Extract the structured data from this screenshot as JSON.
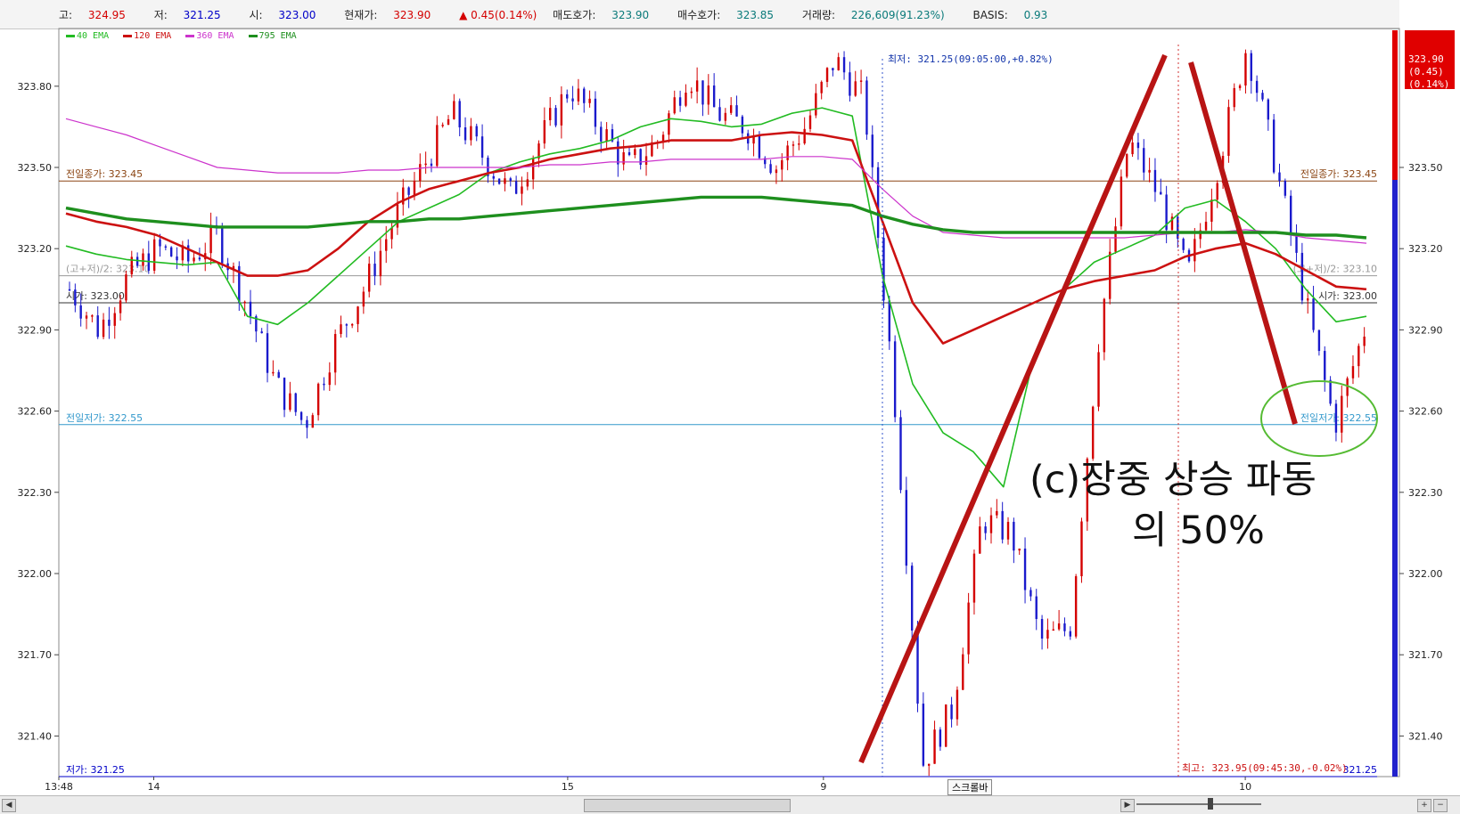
{
  "header": {
    "high_label": "고:",
    "high": "324.95",
    "low_label": "저:",
    "low": "321.25",
    "open_label": "시:",
    "open": "323.00",
    "price_label": "현재가:",
    "price": "323.90",
    "change": "▲ 0.45(0.14%)",
    "ask_label": "매도호가:",
    "ask": "323.90",
    "bid_label": "매수호가:",
    "bid": "323.85",
    "volume_label": "거래량:",
    "volume": "226,609(91.23%)",
    "basis_label": "BASIS:",
    "basis": "0.93"
  },
  "legend": [
    {
      "label": "40 EMA",
      "color": "#22bb22"
    },
    {
      "label": "120 EMA",
      "color": "#cc1111"
    },
    {
      "label": "360 EMA",
      "color": "#cc33cc"
    },
    {
      "label": "795 EMA",
      "color": "#1e8f1e"
    }
  ],
  "chart_data": {
    "type": "line",
    "ylim": [
      321.25,
      324.0
    ],
    "y_ticks": [
      "321.40",
      "321.70",
      "322.00",
      "322.30",
      "322.60",
      "322.90",
      "323.20",
      "323.50",
      "323.80"
    ],
    "x_ticks": [
      "13:48",
      "14",
      "15",
      "9",
      "10"
    ],
    "reference_lines": [
      {
        "label": "전일종가: 323.45",
        "right_label": "전일종가: 323.45",
        "value": 323.45,
        "color": "#8b4513"
      },
      {
        "label": "(고+저)/2: 323.10",
        "right_label": "(고+저)/2: 323.10",
        "value": 323.1,
        "color": "#999999"
      },
      {
        "label": "시가: 323.00",
        "right_label": "시가: 323.00",
        "value": 323.0,
        "color": "#333333"
      },
      {
        "label": "전일저가: 322.55",
        "right_label": "전일저가: 322.55",
        "value": 322.55,
        "color": "#3399cc"
      },
      {
        "label": "저가: 321.25",
        "right_label": "321.25",
        "value": 321.25,
        "color": "#0000c8"
      }
    ],
    "annotations": {
      "low_point": "최저: 321.25(09:05:00,+0.82%)",
      "high_point": "최고: 323.95(09:45:30,-0.02%)",
      "text_line1": "(c)장중 상승 파동",
      "text_line2": "의 50%"
    },
    "current_price_box": [
      "323.90",
      "(0.45)",
      "(0.14%)"
    ],
    "right_axis_ticks": [
      "323.50",
      "323.20",
      "322.90",
      "322.60",
      "322.30",
      "322.00",
      "321.70",
      "321.40"
    ],
    "series": [
      {
        "name": "40 EMA",
        "color": "#22bb22",
        "values": [
          323.21,
          323.18,
          323.16,
          323.15,
          323.14,
          323.15,
          322.95,
          322.92,
          323.0,
          323.1,
          323.2,
          323.3,
          323.35,
          323.4,
          323.48,
          323.52,
          323.55,
          323.57,
          323.6,
          323.65,
          323.68,
          323.67,
          323.65,
          323.66,
          323.7,
          323.72,
          323.69,
          323.1,
          322.7,
          322.52,
          322.45,
          322.32,
          322.8,
          323.05,
          323.15,
          323.2,
          323.25,
          323.35,
          323.38,
          323.3,
          323.2,
          323.05,
          322.93,
          322.95
        ]
      },
      {
        "name": "120 EMA",
        "color": "#cc1111",
        "values": [
          323.33,
          323.3,
          323.28,
          323.25,
          323.2,
          323.15,
          323.1,
          323.1,
          323.12,
          323.2,
          323.3,
          323.37,
          323.42,
          323.45,
          323.48,
          323.5,
          323.53,
          323.55,
          323.57,
          323.58,
          323.6,
          323.6,
          323.6,
          323.62,
          323.63,
          323.62,
          323.6,
          323.3,
          323.0,
          322.85,
          322.9,
          322.95,
          323.0,
          323.05,
          323.08,
          323.1,
          323.12,
          323.17,
          323.2,
          323.22,
          323.18,
          323.12,
          323.06,
          323.05
        ]
      },
      {
        "name": "360 EMA",
        "color": "#cc33cc",
        "values": [
          323.68,
          323.65,
          323.62,
          323.58,
          323.54,
          323.5,
          323.49,
          323.48,
          323.48,
          323.48,
          323.49,
          323.49,
          323.5,
          323.5,
          323.5,
          323.5,
          323.51,
          323.51,
          323.52,
          323.52,
          323.53,
          323.53,
          323.53,
          323.53,
          323.54,
          323.54,
          323.53,
          323.42,
          323.32,
          323.26,
          323.25,
          323.24,
          323.24,
          323.24,
          323.24,
          323.24,
          323.25,
          323.26,
          323.26,
          323.27,
          323.26,
          323.24,
          323.23,
          323.22
        ]
      },
      {
        "name": "795 EMA",
        "color": "#1e8f1e",
        "values": [
          323.35,
          323.33,
          323.31,
          323.3,
          323.29,
          323.28,
          323.28,
          323.28,
          323.28,
          323.29,
          323.3,
          323.3,
          323.31,
          323.31,
          323.32,
          323.33,
          323.34,
          323.35,
          323.36,
          323.37,
          323.38,
          323.39,
          323.39,
          323.39,
          323.38,
          323.37,
          323.36,
          323.32,
          323.29,
          323.27,
          323.26,
          323.26,
          323.26,
          323.26,
          323.26,
          323.26,
          323.26,
          323.26,
          323.26,
          323.26,
          323.26,
          323.25,
          323.25,
          323.24
        ]
      }
    ],
    "price_path": [
      323.05,
      322.9,
      323.1,
      323.2,
      323.15,
      323.25,
      323.0,
      322.7,
      322.55,
      322.85,
      323.05,
      323.3,
      323.5,
      323.7,
      323.55,
      323.4,
      323.6,
      323.8,
      323.65,
      323.5,
      323.6,
      323.85,
      323.7,
      323.65,
      323.5,
      323.65,
      323.9,
      323.75,
      322.7,
      321.3,
      321.5,
      322.2,
      322.15,
      321.75,
      321.8,
      322.9,
      323.6,
      323.4,
      323.1,
      323.5,
      323.95,
      323.5,
      323.0,
      322.55,
      322.9
    ]
  }
}
